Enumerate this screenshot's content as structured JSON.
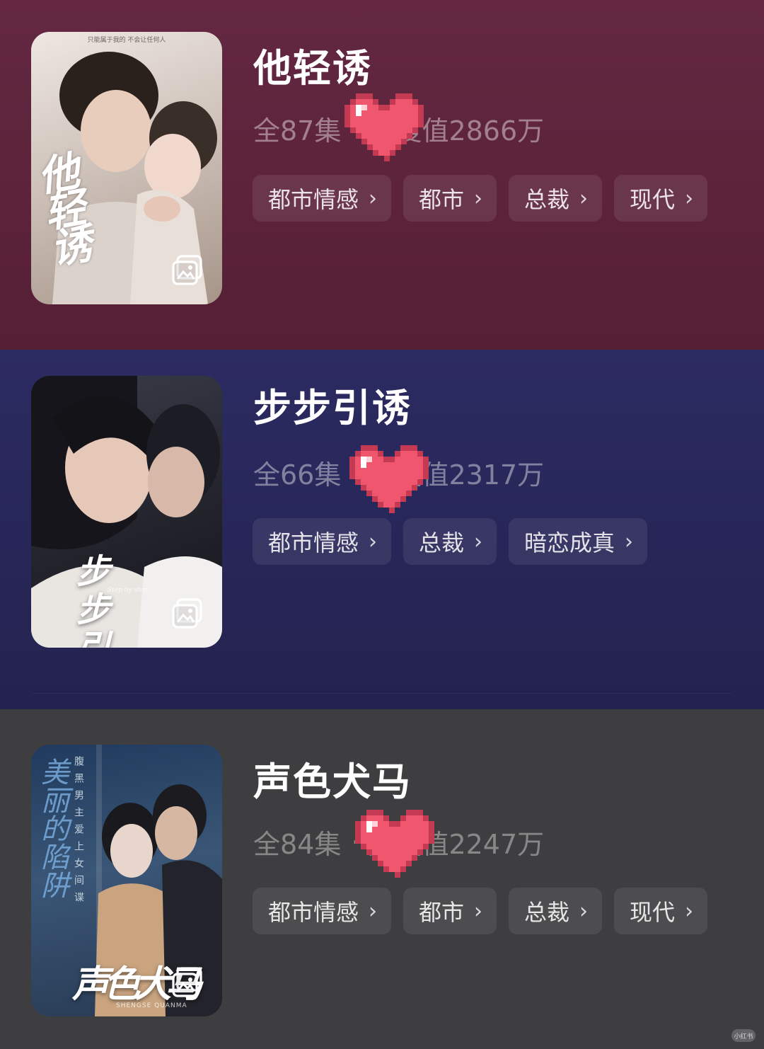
{
  "dramas": [
    {
      "title": "他轻诱",
      "episodes": "全87集",
      "separator": "·",
      "heat": "热度值2866万",
      "tags": [
        "都市情感",
        "都市",
        "总裁",
        "现代"
      ],
      "poster": {
        "calligraphy": "他轻诱",
        "topline": "只能属于我的 不会让任何人"
      }
    },
    {
      "title": "步步引诱",
      "episodes": "全66集",
      "separator": "·",
      "heat": "热度值2317万",
      "tags": [
        "都市情感",
        "总裁",
        "暗恋成真"
      ],
      "poster": {
        "calligraphy": "步步引诱",
        "subtitle": "Step by step"
      }
    },
    {
      "title": "声色犬马",
      "episodes": "全84集",
      "separator": "·",
      "heat": "热度值2247万",
      "tags": [
        "都市情感",
        "都市",
        "总裁",
        "现代"
      ],
      "poster": {
        "calligraphy": "声色犬马",
        "vertical_big": "美丽的陷阱",
        "vertical_small": "腹黑男主爱上女间谍",
        "subtitle": "SHENGSE QUANMA"
      }
    }
  ],
  "tag_chevron": "›",
  "watermark": "小红书",
  "icons": {
    "gallery": "gallery-icon",
    "heart": "pixel-heart-sticker",
    "chevron": "chevron-right-icon"
  },
  "colors": {
    "card1_bg": "#5c2339",
    "card2_bg": "#282659",
    "card3_bg": "#3e3e40",
    "heart": "#f0576e",
    "heart_outline": "#c43a52"
  }
}
